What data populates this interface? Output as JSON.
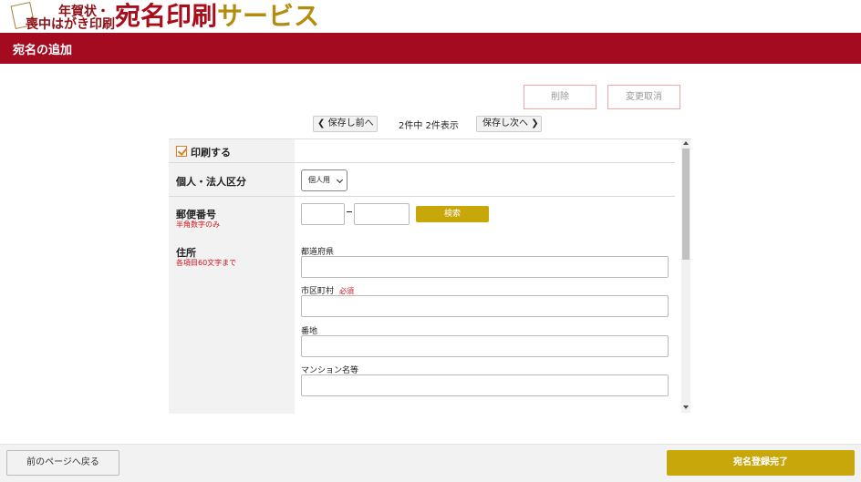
{
  "header": {
    "logo_line1": "年賀状・",
    "logo_line2": "喪中はがき印刷",
    "logo_main_red": "宛名印刷",
    "logo_main_gold": "サービス"
  },
  "titlebar": {
    "title": "宛名の追加"
  },
  "actions": {
    "delete_label": "削除",
    "cancel_label": "変更取消"
  },
  "pager": {
    "prev_label": "保存し前へ",
    "info": "2件中 2件表示",
    "next_label": "保存し次へ"
  },
  "form": {
    "print": {
      "label": "印刷する",
      "checked": true
    },
    "category": {
      "label": "個人・法人区分",
      "selected": "個人用"
    },
    "zip": {
      "label": "郵便番号",
      "note": "半角数字のみ",
      "search_label": "検索",
      "value1": "",
      "value2": ""
    },
    "address": {
      "label": "住所",
      "note": "各項目60文字まで",
      "prefecture_label": "都道府県",
      "city_label": "市区町村",
      "required_label": "必須",
      "street_label": "番地",
      "building_label": "マンション名等"
    }
  },
  "footer": {
    "back_label": "前のページへ戻る",
    "done_label": "宛名登録完了"
  },
  "colors": {
    "brand_red": "#a50b20",
    "accent_gold": "#c8a70a",
    "required_red": "#d0121b"
  }
}
